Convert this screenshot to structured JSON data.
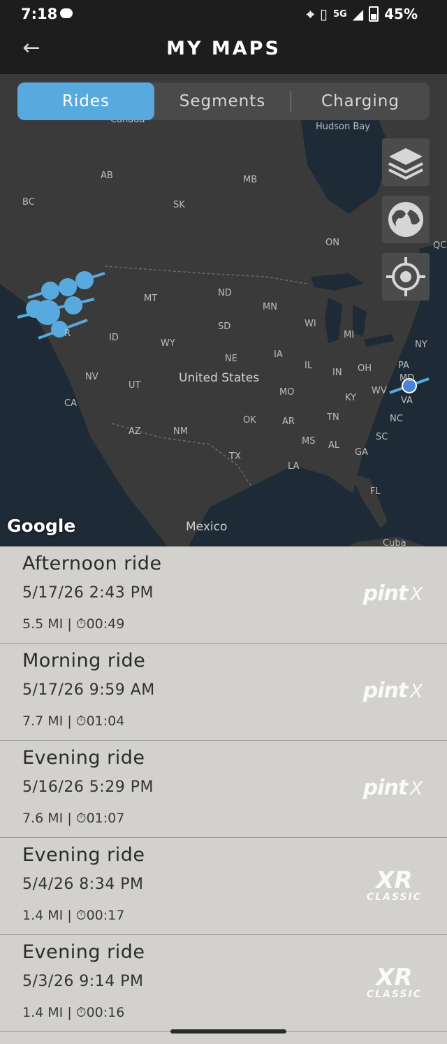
{
  "status": {
    "time": "7:18",
    "network": "5G",
    "battery": "45%"
  },
  "header": {
    "title": "MY MAPS",
    "back_icon": "arrow-left-icon"
  },
  "tabs": [
    {
      "label": "Rides",
      "active": true
    },
    {
      "label": "Segments",
      "active": false
    },
    {
      "label": "Charging",
      "active": false
    }
  ],
  "map": {
    "attribution": "Google",
    "labels": {
      "canada": "Canada",
      "hudson": "Hudson Bay",
      "ab": "AB",
      "bc": "BC",
      "mb": "MB",
      "sk": "SK",
      "on": "ON",
      "qc": "QC",
      "mt": "MT",
      "nd": "ND",
      "mn": "MN",
      "sd": "SD",
      "wi": "WI",
      "mi": "MI",
      "ny": "NY",
      "id": "ID",
      "wy": "WY",
      "ne": "NE",
      "ia": "IA",
      "il": "IL",
      "in": "IN",
      "oh": "OH",
      "pa": "PA",
      "md": "MD",
      "nv": "NV",
      "ut": "UT",
      "us": "United States",
      "mo": "MO",
      "ky": "KY",
      "wv": "WV",
      "va": "VA",
      "ca": "CA",
      "ok": "OK",
      "ar": "AR",
      "tn": "TN",
      "nc": "NC",
      "az": "AZ",
      "nm": "NM",
      "ms": "MS",
      "al": "AL",
      "sc": "SC",
      "ga": "GA",
      "tx": "TX",
      "la": "LA",
      "fl": "FL",
      "mexico": "Mexico",
      "cuba": "Cuba",
      "or": "R"
    },
    "buttons": [
      "layers-icon",
      "globe-icon",
      "crosshair-icon"
    ],
    "accent": "#58a9de"
  },
  "rides": [
    {
      "name": "Afternoon ride",
      "date": "5/17/26 2:43 PM",
      "distance": "5.5 MI",
      "duration": "00:49",
      "board": "pint",
      "board_suffix": "X"
    },
    {
      "name": "Morning ride",
      "date": "5/17/26 9:59 AM",
      "distance": "7.7 MI",
      "duration": "01:04",
      "board": "pint",
      "board_suffix": "X"
    },
    {
      "name": "Evening ride",
      "date": "5/16/26 5:29 PM",
      "distance": "7.6 MI",
      "duration": "01:07",
      "board": "pint",
      "board_suffix": "X"
    },
    {
      "name": "Evening ride",
      "date": "5/4/26 8:34 PM",
      "distance": "1.4 MI",
      "duration": "00:17",
      "board": "XR",
      "board_suffix": "CLASSIC"
    },
    {
      "name": "Evening ride",
      "date": "5/3/26 9:14 PM",
      "distance": "1.4 MI",
      "duration": "00:16",
      "board": "XR",
      "board_suffix": "CLASSIC"
    }
  ],
  "separator": "|"
}
